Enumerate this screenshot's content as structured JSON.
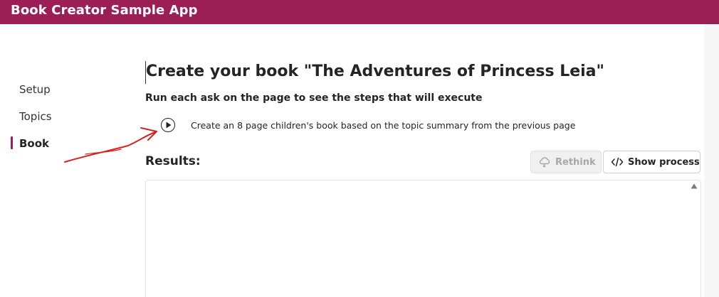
{
  "app": {
    "title": "Book Creator Sample App"
  },
  "nav": {
    "items": [
      {
        "label": "Setup",
        "active": false
      },
      {
        "label": "Topics",
        "active": false
      },
      {
        "label": "Book",
        "active": true
      }
    ]
  },
  "main": {
    "title": "Create your book \"The Adventures of Princess Leia\"",
    "instructions": "Run each ask on the page to see the steps that will execute",
    "ask": {
      "text": "Create an 8 page children's book based on the topic summary from the previous page",
      "icon": "play-circle-icon"
    },
    "results": {
      "label": "Results:",
      "rethink_label": "Rethink",
      "rethink_icon": "cloud-icon",
      "show_process_label": "Show process",
      "show_process_icon": "code-icon"
    }
  },
  "colors": {
    "brand": "#9b1f55",
    "annotation": "#d62222"
  }
}
